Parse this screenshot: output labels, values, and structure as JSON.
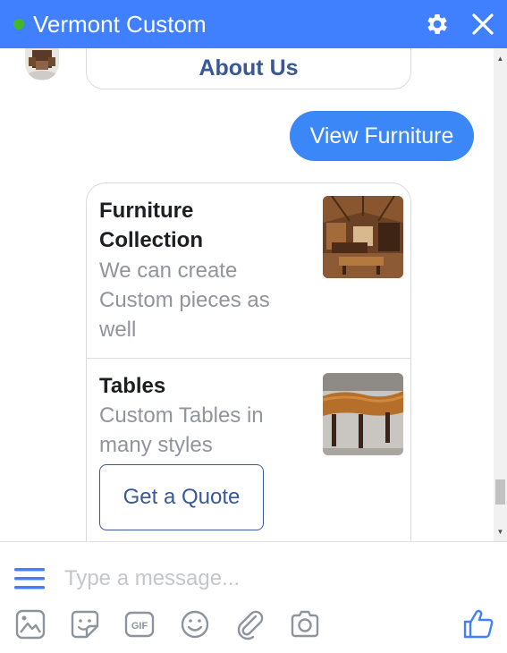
{
  "header": {
    "title": "Vermont Custom",
    "status": "online",
    "icons": [
      "gear-icon",
      "close-icon"
    ]
  },
  "conversation": {
    "about_button_label": "About Us",
    "user_message": "View Furniture",
    "list": [
      {
        "title": "Furniture Collection",
        "title_line1": "Furniture",
        "title_line2": "Collection",
        "subtitle_line1": "We can create",
        "subtitle_line2": "Custom pieces as",
        "subtitle_line3": "well",
        "image": "furniture-room-photo"
      },
      {
        "title": "Tables",
        "subtitle_line1": "Custom Tables in",
        "subtitle_line2": "many styles",
        "image": "wood-table-photo",
        "button_label": "Get a Quote"
      }
    ]
  },
  "composer": {
    "placeholder": "Type a message...",
    "tools": [
      "image-icon",
      "sticker-icon",
      "gif-icon",
      "emoji-icon",
      "attachment-icon",
      "camera-icon"
    ],
    "like": "thumbs-up-icon"
  },
  "colors": {
    "header": "#4080ff",
    "user_bubble": "#3b87f7",
    "link": "#385898",
    "online": "#42b72a"
  }
}
